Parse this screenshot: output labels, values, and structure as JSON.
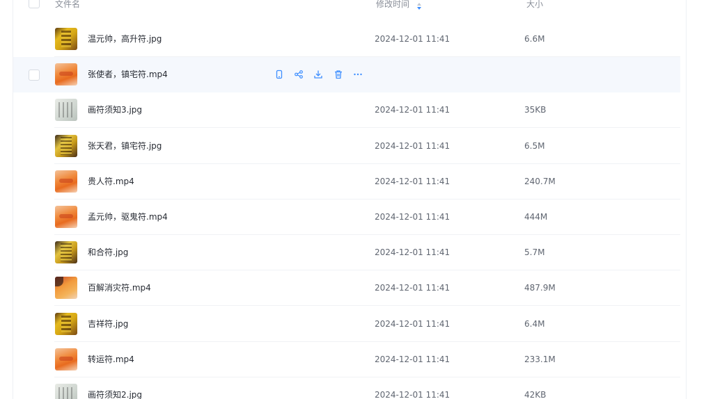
{
  "header": {
    "name_label": "文件名",
    "time_label": "修改时间",
    "size_label": "大小"
  },
  "files": [
    {
      "name": "温元帅，高升符.jpg",
      "modified": "2024-12-01 11:41",
      "size": "6.6M",
      "thumb": "yellow"
    },
    {
      "name": "张使者，镇宅符.mp4",
      "modified": "",
      "size": "",
      "thumb": "orange",
      "hovered": true
    },
    {
      "name": "画符须知3.jpg",
      "modified": "2024-12-01 11:41",
      "size": "35KB",
      "thumb": "paper"
    },
    {
      "name": "张天君，镇宅符.jpg",
      "modified": "2024-12-01 11:41",
      "size": "6.5M",
      "thumb": "dark"
    },
    {
      "name": "贵人符.mp4",
      "modified": "2024-12-01 11:41",
      "size": "240.7M",
      "thumb": "orange"
    },
    {
      "name": "孟元帅，驱鬼符.mp4",
      "modified": "2024-12-01 11:41",
      "size": "444M",
      "thumb": "orange"
    },
    {
      "name": "和合符.jpg",
      "modified": "2024-12-01 11:41",
      "size": "5.7M",
      "thumb": "dark"
    },
    {
      "name": "百解消灾符.mp4",
      "modified": "2024-12-01 11:41",
      "size": "487.9M",
      "thumb": "red"
    },
    {
      "name": "吉祥符.jpg",
      "modified": "2024-12-01 11:41",
      "size": "6.4M",
      "thumb": "yellow"
    },
    {
      "name": "转运符.mp4",
      "modified": "2024-12-01 11:41",
      "size": "233.1M",
      "thumb": "orange"
    },
    {
      "name": "画符须知2.jpg",
      "modified": "2024-12-01 11:41",
      "size": "42KB",
      "thumb": "paper"
    }
  ],
  "row_actions": [
    {
      "icon": "phone-icon"
    },
    {
      "icon": "share-icon"
    },
    {
      "icon": "download-icon"
    },
    {
      "icon": "delete-icon"
    },
    {
      "icon": "more-icon"
    }
  ],
  "colors": {
    "accent": "#3d8eff",
    "hover_row": "#f5f8fd",
    "divider": "#f0f2f5"
  }
}
